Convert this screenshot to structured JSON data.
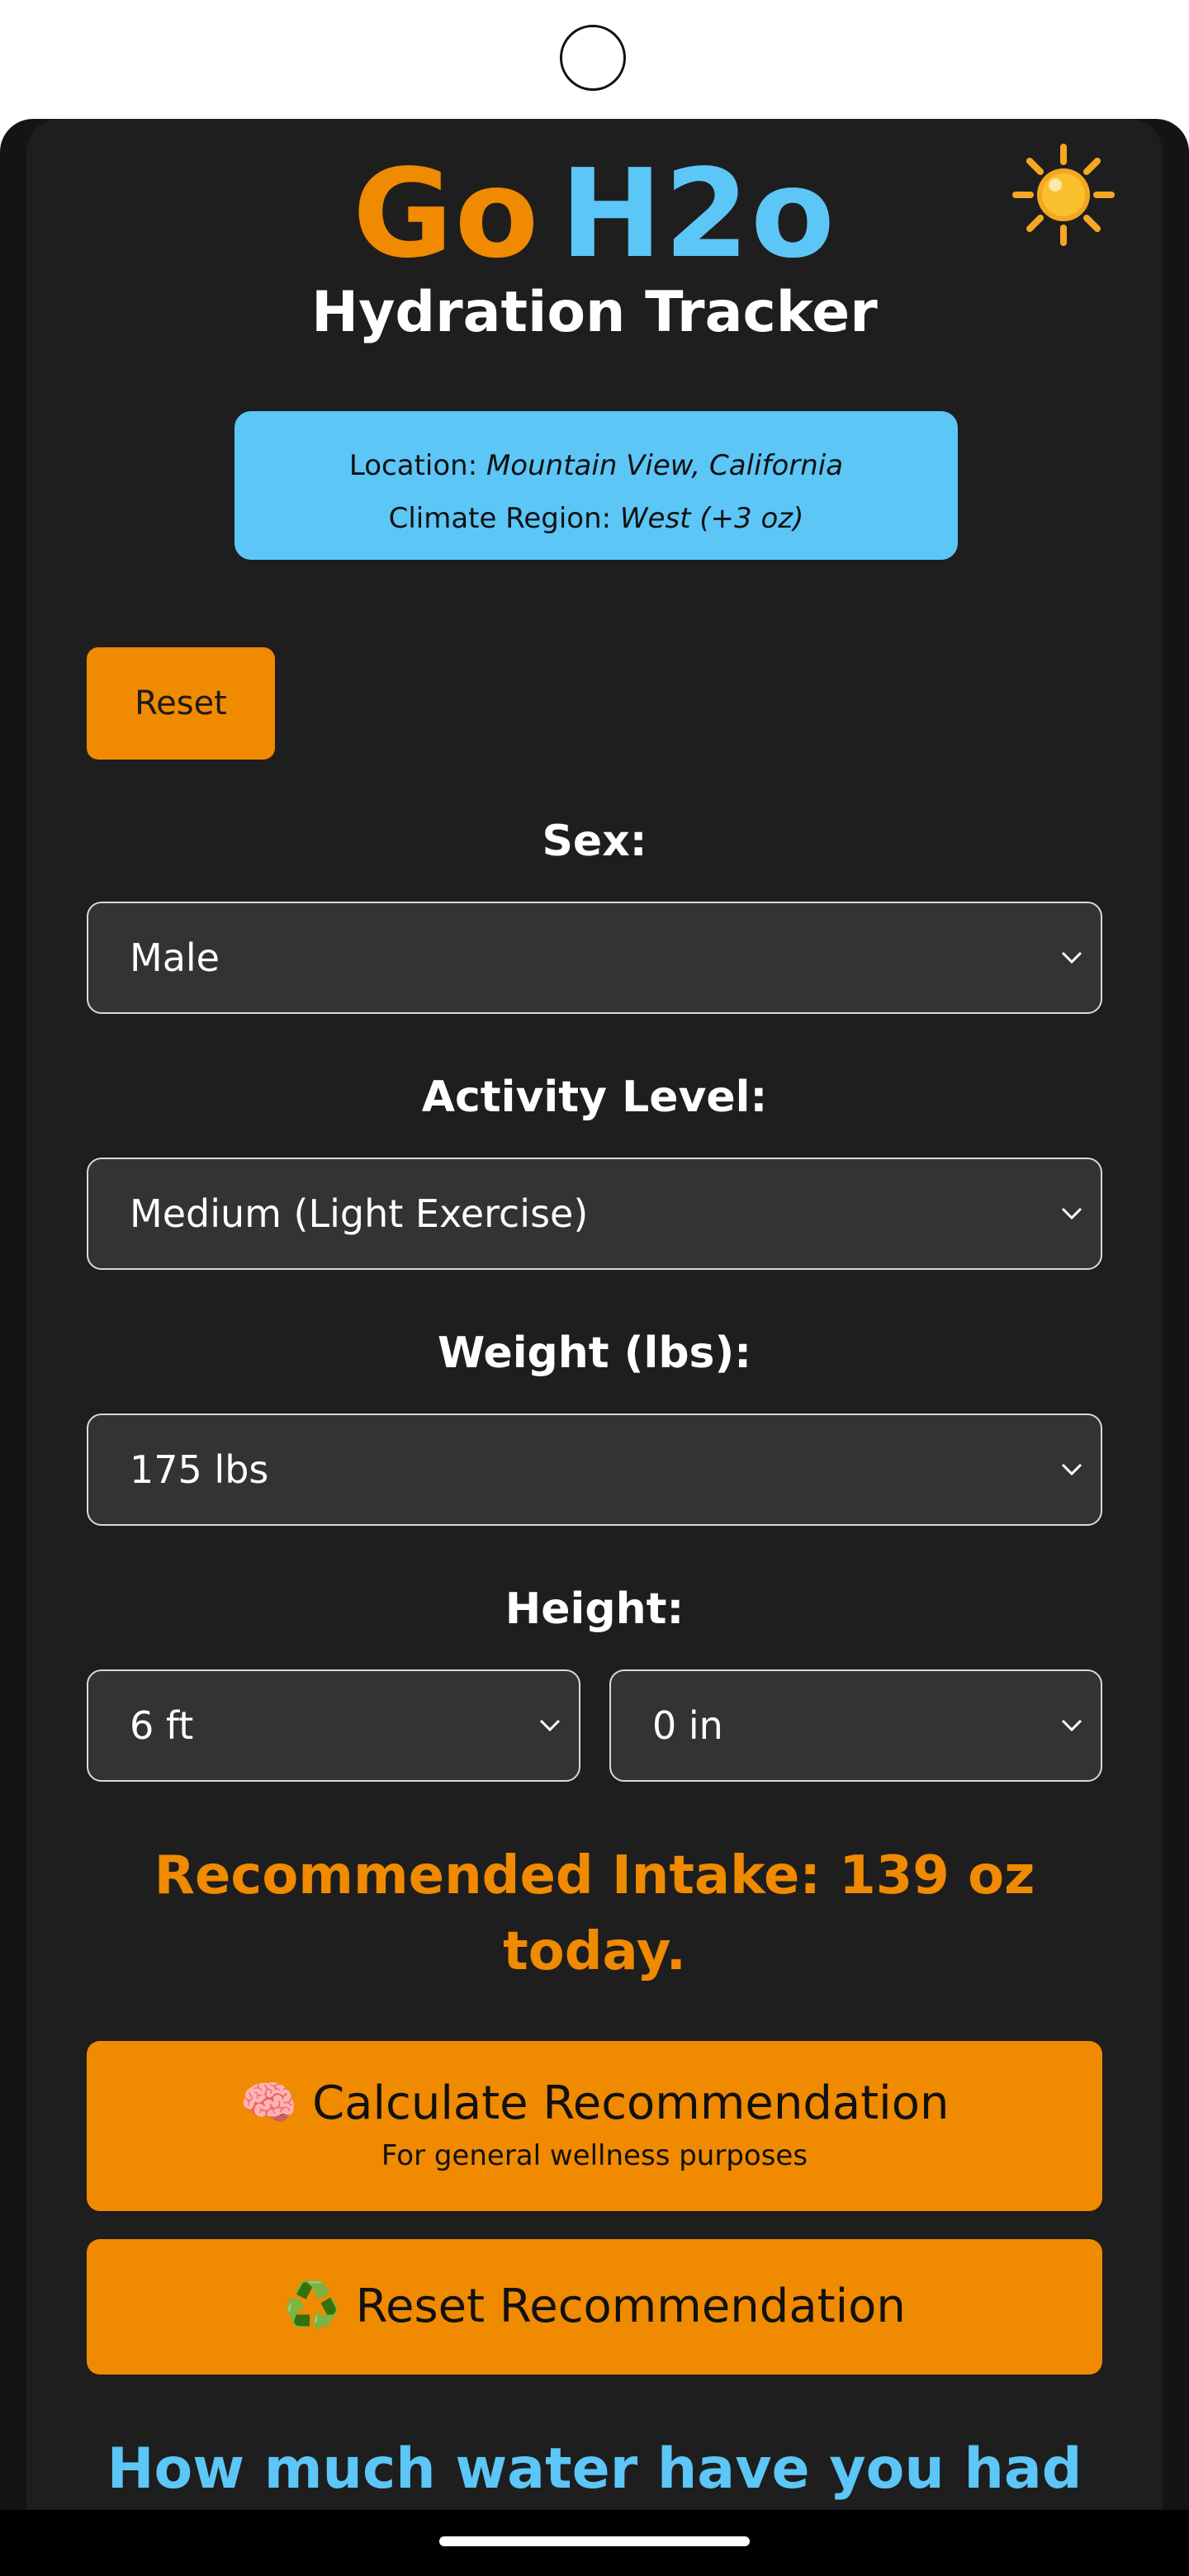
{
  "app": {
    "title_go": "Go",
    "title_h2o": "H2o",
    "subtitle": "Hydration Tracker",
    "weather_icon": "sun-icon",
    "colors": {
      "accent_orange": "#f08a00",
      "accent_blue": "#5cc6f7",
      "background": "#1e1e1e"
    }
  },
  "location": {
    "location_label": "Location:",
    "location_value": "Mountain View, California",
    "climate_label": "Climate Region:",
    "climate_value": "West (+3 oz)"
  },
  "reset_button_label": "Reset",
  "form": {
    "sex_label": "Sex:",
    "sex_value": "Male",
    "activity_label": "Activity Level:",
    "activity_value": "Medium (Light Exercise)",
    "weight_label": "Weight (lbs):",
    "weight_value": "175 lbs",
    "height_label": "Height:",
    "height_ft_value": "6 ft",
    "height_in_value": "0 in"
  },
  "recommendation": {
    "text": "Recommended Intake: 139 oz today."
  },
  "buttons": {
    "calculate_icon": "🧠",
    "calculate_label": "Calculate Recommendation",
    "calculate_sub": "For general wellness purposes",
    "reset_rec_icon": "♻️",
    "reset_rec_label": "Reset Recommendation"
  },
  "water_heading": "How much water have you had"
}
